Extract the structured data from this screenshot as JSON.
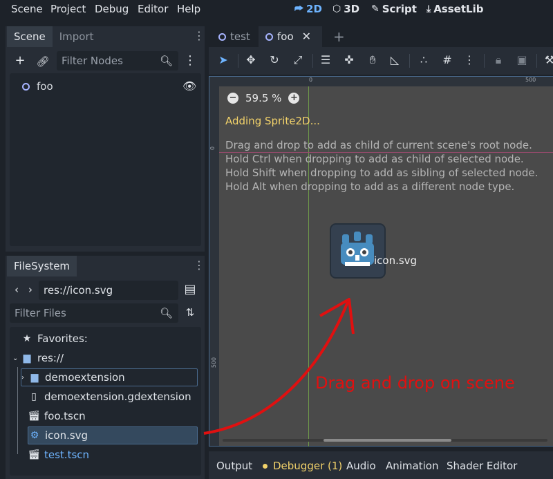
{
  "menu": {
    "items": [
      "Scene",
      "Project",
      "Debug",
      "Editor",
      "Help"
    ],
    "workspaces": [
      "2D",
      "3D",
      "Script",
      "AssetLib"
    ],
    "active_workspace": "2D"
  },
  "scene_dock": {
    "tabs": [
      "Scene",
      "Import"
    ],
    "filter_placeholder": "Filter Nodes",
    "root_node": "foo"
  },
  "filesystem_dock": {
    "tab": "FileSystem",
    "path": "res://icon.svg",
    "filter_placeholder": "Filter Files",
    "favorites_label": "Favorites:",
    "root_label": "res://",
    "items": [
      {
        "name": "demoextension",
        "icon": "folder-icon"
      },
      {
        "name": "demoextension.gdextension",
        "icon": "file-icon"
      },
      {
        "name": "foo.tscn",
        "icon": "scene-icon"
      },
      {
        "name": "icon.svg",
        "icon": "godot-icon"
      },
      {
        "name": "test.tscn",
        "icon": "scene-icon"
      }
    ]
  },
  "scene_tabs": {
    "tabs": [
      "test",
      "foo"
    ],
    "active": "foo"
  },
  "viewport": {
    "zoom": "59.5 %",
    "ruler_top": [
      "0",
      "500"
    ],
    "ruler_left": [
      "0",
      "500"
    ],
    "adding_message": "Adding Sprite2D...",
    "hints": [
      "Drag and drop to add as child of current scene's root node.",
      "Hold Ctrl when dropping to add as child of selected node.",
      "Hold Shift when dropping to add as sibling of selected node.",
      "Hold Alt when dropping to add as a different node type."
    ],
    "drag_label": "icon.svg",
    "annotation": "Drag and drop on scene",
    "annotation_color": "#e01010"
  },
  "bottom_panel": {
    "tabs": [
      "Output",
      "Debugger (1)",
      "Audio",
      "Animation",
      "Shader Editor"
    ]
  },
  "colors": {
    "accent": "#6eb4ff",
    "warning": "#f2d26a"
  }
}
